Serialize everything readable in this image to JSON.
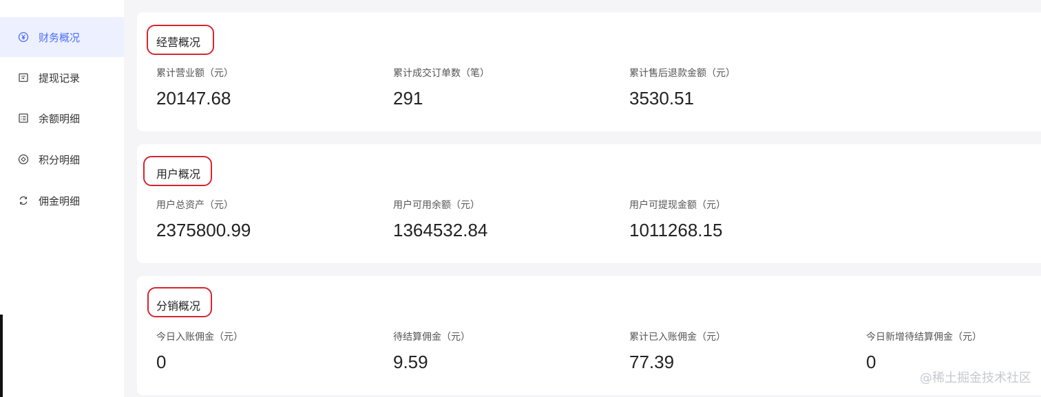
{
  "sidebar": {
    "items": [
      {
        "icon": "yen-circle-icon",
        "label": "财务概况",
        "active": true
      },
      {
        "icon": "withdraw-record-icon",
        "label": "提现记录"
      },
      {
        "icon": "list-detail-icon",
        "label": "余额明细"
      },
      {
        "icon": "points-target-icon",
        "label": "积分明细"
      },
      {
        "icon": "commission-cycle-icon",
        "label": "佣金明细"
      }
    ]
  },
  "sections": [
    {
      "title": "经营概况",
      "stats": [
        {
          "label": "累计营业额（元）",
          "value": "20147.68"
        },
        {
          "label": "累计成交订单数（笔）",
          "value": "291"
        },
        {
          "label": "累计售后退款金额（元）",
          "value": "3530.51"
        }
      ]
    },
    {
      "title": "用户概况",
      "stats": [
        {
          "label": "用户总资产（元）",
          "value": "2375800.99"
        },
        {
          "label": "用户可用余额（元）",
          "value": "1364532.84"
        },
        {
          "label": "用户可提现金额（元）",
          "value": "1011268.15"
        }
      ]
    },
    {
      "title": "分销概况",
      "stats": [
        {
          "label": "今日入账佣金（元）",
          "value": "0"
        },
        {
          "label": "待结算佣金（元）",
          "value": "9.59"
        },
        {
          "label": "累计已入账佣金（元）",
          "value": "77.39"
        },
        {
          "label": "今日新增待结算佣金（元）",
          "value": "0"
        }
      ]
    }
  ],
  "watermark": "@稀土掘金技术社区",
  "colors": {
    "accent": "#4a6cf7",
    "highlight": "#d5242f",
    "active_bg": "#edf1ff"
  }
}
